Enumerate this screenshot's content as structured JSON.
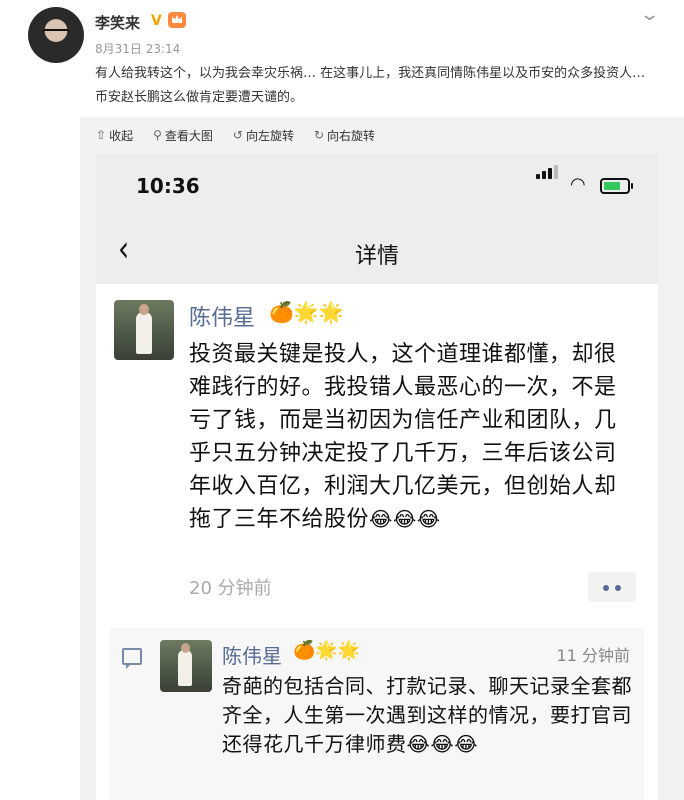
{
  "post": {
    "author": "李笑来",
    "verified_badge": "V",
    "time": "8月31日 23:14",
    "text": "有人给我转这个，以为我会幸灾乐祸… 在这事儿上，我还真同情陈伟星以及币安的众多投资人… 币安赵长鹏这么做肯定要遭天谴的。"
  },
  "toolbar": {
    "collapse": "收起",
    "view_large": "查看大图",
    "rotate_left": "向左旋转",
    "rotate_right": "向右旋转"
  },
  "screenshot": {
    "clock": "10:36",
    "nav_title": "详情",
    "main_post": {
      "name": "陈伟星",
      "badges": "🍊🌟🌟",
      "text": "投资最关键是投人，这个道理谁都懂，却很难践行的好。我投错人最恶心的一次，不是亏了钱，而是当初因为信任产业和团队，几乎只五分钟决定投了几千万，三年后该公司年收入百亿，利润大几亿美元，但创始人却拖了三年不给股份",
      "emojis": "😂😂😂",
      "time": "20 分钟前"
    },
    "comment": {
      "name": "陈伟星",
      "badges": "🍊🌟🌟",
      "time": "11 分钟前",
      "text": "奇葩的包括合同、打款记录、聊天记录全套都齐全，人生第一次遇到这样的情况，要打官司还得花几千万律师费",
      "emojis": "😂😂😂"
    }
  },
  "colors": {
    "link_blue": "#576b95",
    "verified_orange": "#f5a200",
    "battery_green": "#34c759"
  }
}
